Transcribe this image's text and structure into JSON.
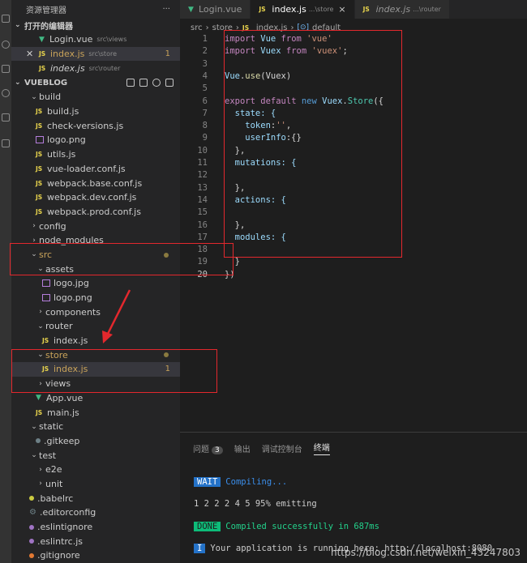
{
  "explorer": {
    "title": "资源管理器",
    "more": "···",
    "open_editors": {
      "label": "打开的编辑器",
      "items": [
        {
          "name": "Login.vue",
          "path": "src\\views"
        },
        {
          "name": "index.js",
          "path": "src\\store",
          "badge": "1"
        },
        {
          "name": "index.js",
          "path": "src\\router"
        }
      ]
    },
    "project": "VUEBLOG",
    "tree": [
      "build",
      "build.js",
      "check-versions.js",
      "logo.png",
      "utils.js",
      "vue-loader.conf.js",
      "webpack.base.conf.js",
      "webpack.dev.conf.js",
      "webpack.prod.conf.js",
      "config",
      "node_modules",
      "src",
      "assets",
      "logo.jpg",
      "logo.png",
      "components",
      "router",
      "index.js",
      "store",
      "index.js",
      "views",
      "App.vue",
      "main.js",
      "static",
      ".gitkeep",
      "test",
      "e2e",
      "unit",
      ".babelrc",
      ".editorconfig",
      ".eslintignore",
      ".eslintrc.js",
      ".gitignore"
    ],
    "store_badge": "1"
  },
  "tabs": [
    {
      "label": "Login.vue"
    },
    {
      "label": "index.js",
      "sub": "...\\store",
      "close": "×"
    },
    {
      "label": "index.js",
      "sub": "...\\router"
    }
  ],
  "breadcrumb": [
    "src",
    "store",
    "index.js",
    "default"
  ],
  "code_lines": [
    "1",
    "2",
    "3",
    "4",
    "5",
    "6",
    "7",
    "8",
    "9",
    "10",
    "11",
    "12",
    "13",
    "14",
    "15",
    "16",
    "17",
    "18",
    "19",
    "20"
  ],
  "code_text": {
    "l1": [
      "import",
      " Vue ",
      "from",
      " 'vue'"
    ],
    "l2": [
      "import",
      " Vuex ",
      "from",
      " 'vuex'",
      ";"
    ],
    "l4": [
      "Vue",
      ".",
      "use",
      "(Vuex)"
    ],
    "l6": [
      "export",
      " default",
      " new",
      " Vuex",
      ".",
      "Store",
      "({"
    ],
    "l7": "  state: {",
    "l8": [
      "    token",
      ":",
      "''",
      ","
    ],
    "l9": [
      "    userInfo",
      ":{}"
    ],
    "l10": "  },",
    "l11": "  mutations: {",
    "l13": "  },",
    "l14": "  actions: {",
    "l16": "  },",
    "l17": "  modules: {",
    "l19": "  }",
    "l20": "})"
  },
  "panel": {
    "tabs": [
      "问题",
      "输出",
      "调试控制台",
      "终端"
    ],
    "problems_count": "3",
    "terminal": {
      "wait_tag": "WAIT",
      "wait_text": "Compiling...",
      "progress": "1 2 2 2 4 5 95% emitting",
      "done_tag": "DONE",
      "done_text": "Compiled successfully in 687ms",
      "info_tag": "I",
      "info_text": "Your application is running here: http://localhost:8080"
    }
  },
  "watermark": "https://blog.csdn.net/weixin_43247803",
  "colors": {
    "accent_red": "#e3282d",
    "modified": "#c9a35a",
    "js_yellow": "#e8d44d",
    "vue_green": "#41b883"
  }
}
